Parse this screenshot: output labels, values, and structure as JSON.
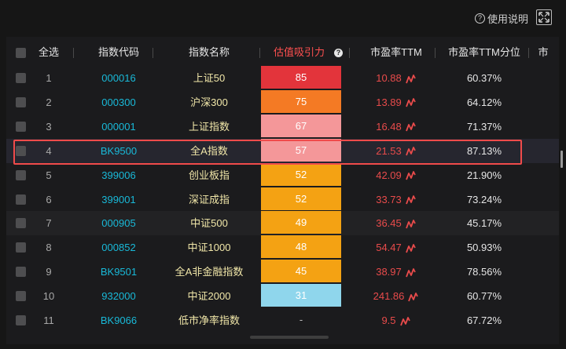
{
  "toolbar": {
    "help_label": "使用说明",
    "help_icon": "question-circle-icon",
    "expand_icon": "expand-icon"
  },
  "table": {
    "headers": {
      "select_all": "全选",
      "code": "指数代码",
      "name": "指数名称",
      "attractiveness": "估值吸引力",
      "pe": "市盈率TTM",
      "pe_percentile": "市盈率TTM分位",
      "cut_column": "市"
    },
    "selected_row": 4,
    "rows": [
      {
        "idx": "1",
        "code": "000016",
        "name": "上证50",
        "score": "85",
        "pe": "10.88",
        "pct": "60.37%",
        "color": "#e3343b"
      },
      {
        "idx": "2",
        "code": "000300",
        "name": "沪深300",
        "score": "75",
        "pe": "13.89",
        "pct": "64.12%",
        "color": "#f47a24"
      },
      {
        "idx": "3",
        "code": "000001",
        "name": "上证指数",
        "score": "67",
        "pe": "16.48",
        "pct": "71.37%",
        "color": "#f49799"
      },
      {
        "idx": "4",
        "code": "BK9500",
        "name": "全A指数",
        "score": "57",
        "pe": "21.53",
        "pct": "87.13%",
        "color": "#f49799"
      },
      {
        "idx": "5",
        "code": "399006",
        "name": "创业板指",
        "score": "52",
        "pe": "42.09",
        "pct": "21.90%",
        "color": "#f4a213"
      },
      {
        "idx": "6",
        "code": "399001",
        "name": "深证成指",
        "score": "52",
        "pe": "33.73",
        "pct": "73.24%",
        "color": "#f4a213"
      },
      {
        "idx": "7",
        "code": "000905",
        "name": "中证500",
        "score": "49",
        "pe": "36.45",
        "pct": "45.17%",
        "color": "#f4a213"
      },
      {
        "idx": "8",
        "code": "000852",
        "name": "中证1000",
        "score": "48",
        "pe": "54.47",
        "pct": "50.93%",
        "color": "#f4a213"
      },
      {
        "idx": "9",
        "code": "BK9501",
        "name": "全A非金融指数",
        "score": "45",
        "pe": "38.97",
        "pct": "78.56%",
        "color": "#f4a213"
      },
      {
        "idx": "10",
        "code": "932000",
        "name": "中证2000",
        "score": "31",
        "pe": "241.86",
        "pct": "60.77%",
        "color": "#8fd6ec"
      },
      {
        "idx": "11",
        "code": "BK9066",
        "name": "低市净率指数",
        "score": "-",
        "pe": "9.5",
        "pct": "67.72%",
        "color": ""
      }
    ]
  }
}
